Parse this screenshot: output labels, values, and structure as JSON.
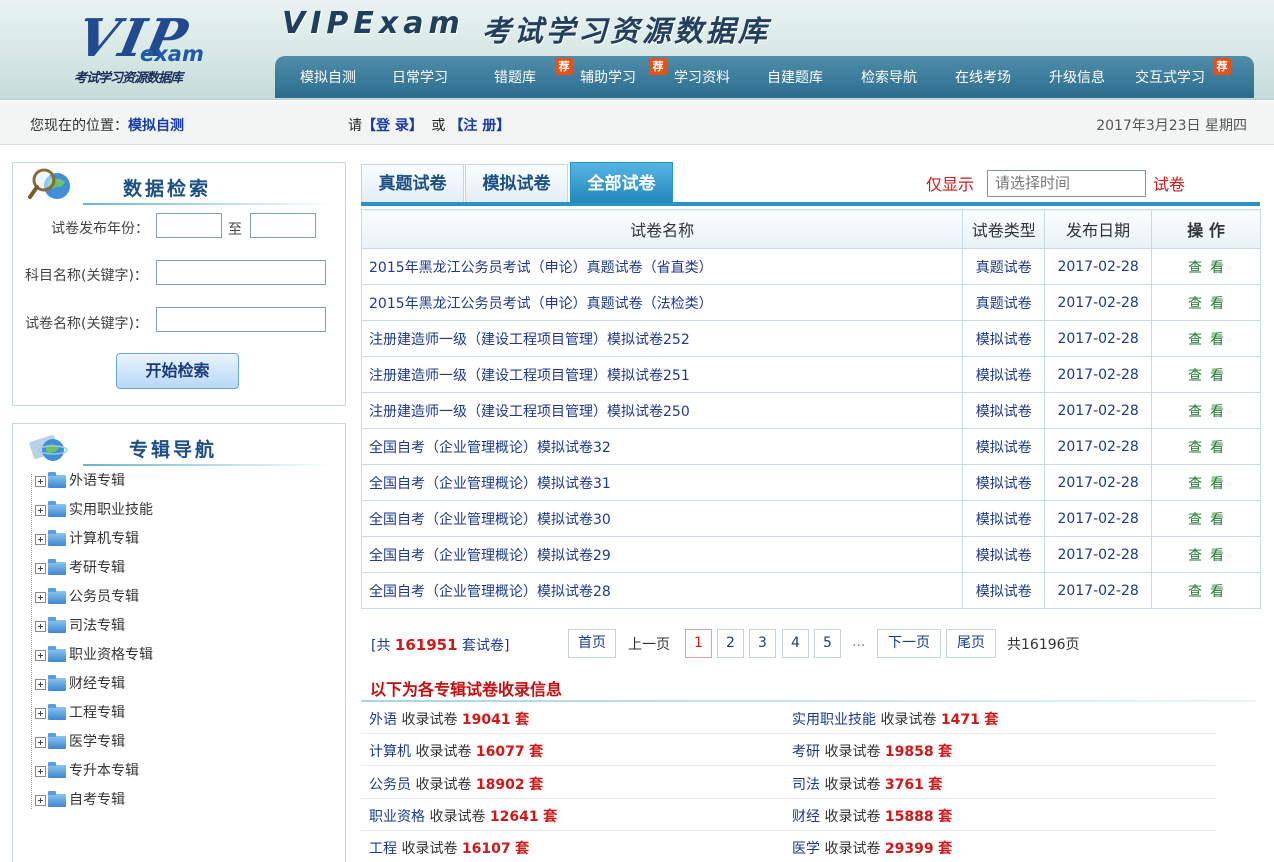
{
  "header": {
    "logo_vip": "VIP",
    "logo_exam": "exam",
    "logo_sub": "考试学习资源数据库",
    "title_en": "VIPExam",
    "title_cn": "考试学习资源数据库",
    "nav": [
      {
        "label": "模拟自测",
        "badge": ""
      },
      {
        "label": "日常学习",
        "badge": ""
      },
      {
        "label": "错题库",
        "badge": ""
      },
      {
        "label": "辅助学习",
        "badge": "荐"
      },
      {
        "label": "学习资料",
        "badge": "荐"
      },
      {
        "label": "自建题库",
        "badge": ""
      },
      {
        "label": "检索导航",
        "badge": ""
      },
      {
        "label": "在线考场",
        "badge": ""
      },
      {
        "label": "升级信息",
        "badge": ""
      },
      {
        "label": "交互式学习",
        "badge": "荐"
      }
    ]
  },
  "location": {
    "prefix": "您现在的位置：",
    "current": "模拟自测",
    "login_prefix": "请",
    "login": "【登  录】",
    "or": "或",
    "register": "【注  册】",
    "date": "2017年3月23日  星期四"
  },
  "search": {
    "title": "数据检索",
    "year_label": "试卷发布年份：",
    "to": "至",
    "subject_label": "科目名称(关键字)：",
    "paper_label": "试卷名称(关键字)：",
    "button": "开始检索"
  },
  "nav_panel": {
    "title": "专辑导航",
    "items": [
      "外语专辑",
      "实用职业技能",
      "计算机专辑",
      "考研专辑",
      "公务员专辑",
      "司法专辑",
      "职业资格专辑",
      "财经专辑",
      "工程专辑",
      "医学专辑",
      "专升本专辑",
      "自考专辑"
    ]
  },
  "tabs": [
    "真题试卷",
    "模拟试卷",
    "全部试卷"
  ],
  "filter": {
    "prefix": "仅显示",
    "placeholder": "请选择时间",
    "suffix": "试卷"
  },
  "table": {
    "headers": [
      "试卷名称",
      "试卷类型",
      "发布日期",
      "操  作"
    ],
    "rows": [
      {
        "name": "2015年黑龙江公务员考试（申论）真题试卷（省直类）",
        "type": "真题试卷",
        "date": "2017-02-28",
        "action": "查看"
      },
      {
        "name": "2015年黑龙江公务员考试（申论）真题试卷（法检类）",
        "type": "真题试卷",
        "date": "2017-02-28",
        "action": "查看"
      },
      {
        "name": "注册建造师一级（建设工程项目管理）模拟试卷252",
        "type": "模拟试卷",
        "date": "2017-02-28",
        "action": "查看"
      },
      {
        "name": "注册建造师一级（建设工程项目管理）模拟试卷251",
        "type": "模拟试卷",
        "date": "2017-02-28",
        "action": "查看"
      },
      {
        "name": "注册建造师一级（建设工程项目管理）模拟试卷250",
        "type": "模拟试卷",
        "date": "2017-02-28",
        "action": "查看"
      },
      {
        "name": "全国自考（企业管理概论）模拟试卷32",
        "type": "模拟试卷",
        "date": "2017-02-28",
        "action": "查看"
      },
      {
        "name": "全国自考（企业管理概论）模拟试卷31",
        "type": "模拟试卷",
        "date": "2017-02-28",
        "action": "查看"
      },
      {
        "name": "全国自考（企业管理概论）模拟试卷30",
        "type": "模拟试卷",
        "date": "2017-02-28",
        "action": "查看"
      },
      {
        "name": "全国自考（企业管理概论）模拟试卷29",
        "type": "模拟试卷",
        "date": "2017-02-28",
        "action": "查看"
      },
      {
        "name": "全国自考（企业管理概论）模拟试卷28",
        "type": "模拟试卷",
        "date": "2017-02-28",
        "action": "查看"
      }
    ]
  },
  "pager": {
    "total_prefix": "[共",
    "total_count": "161951",
    "total_suffix": "套试卷]",
    "first": "首页",
    "prev": "上一页",
    "pages": [
      "1",
      "2",
      "3",
      "4",
      "5"
    ],
    "ellipsis": "...",
    "next": "下一页",
    "last": "尾页",
    "total_pages": "共16196页"
  },
  "collections": {
    "title": "以下为各专辑试卷收录信息",
    "label": "收录试卷",
    "unit": "套",
    "rows": [
      [
        {
          "name": "外语",
          "count": "19041"
        },
        {
          "name": "实用职业技能",
          "count": "1471"
        }
      ],
      [
        {
          "name": "计算机",
          "count": "16077"
        },
        {
          "name": "考研",
          "count": "19858"
        }
      ],
      [
        {
          "name": "公务员",
          "count": "18902"
        },
        {
          "name": "司法",
          "count": "3761"
        }
      ],
      [
        {
          "name": "职业资格",
          "count": "12641"
        },
        {
          "name": "财经",
          "count": "15888"
        }
      ],
      [
        {
          "name": "工程",
          "count": "16107"
        },
        {
          "name": "医学",
          "count": "29399"
        }
      ]
    ]
  }
}
